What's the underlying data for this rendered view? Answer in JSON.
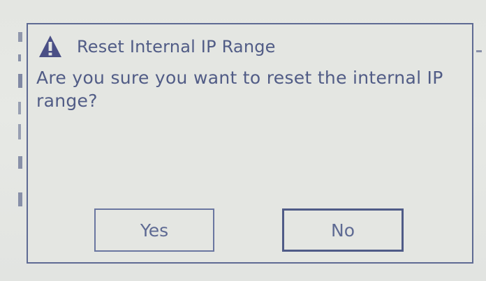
{
  "dialog": {
    "title": "Reset Internal IP Range",
    "icon": "warning-icon",
    "message": "Are you sure you want to reset the internal IP range?",
    "buttons": {
      "yes_label": "Yes",
      "no_label": "No"
    }
  },
  "colors": {
    "text": "#515c86",
    "border": "#5e6a93",
    "background": "#e4e6e2"
  }
}
